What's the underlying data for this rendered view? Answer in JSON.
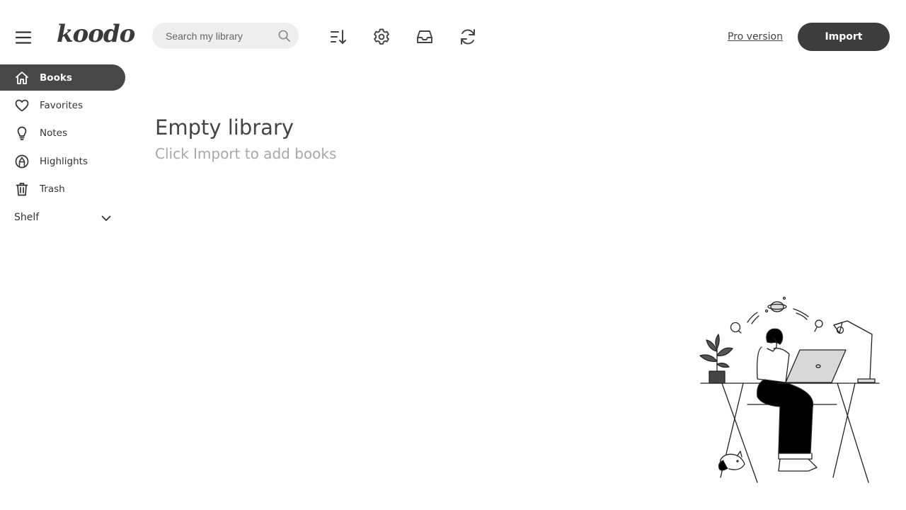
{
  "app": {
    "logo_text": "koodo"
  },
  "header": {
    "search_placeholder": "Search my library",
    "tools": [
      "sort-icon",
      "settings-icon",
      "inbox-icon",
      "sync-icon"
    ],
    "pro_label": "Pro version",
    "import_label": "Import"
  },
  "sidebar": {
    "items": [
      {
        "label": "Books",
        "icon": "home-icon",
        "active": true
      },
      {
        "label": "Favorites",
        "icon": "heart-icon",
        "active": false
      },
      {
        "label": "Notes",
        "icon": "lightbulb-icon",
        "active": false
      },
      {
        "label": "Highlights",
        "icon": "highlighter-icon",
        "active": false
      },
      {
        "label": "Trash",
        "icon": "trash-icon",
        "active": false
      }
    ],
    "shelf_label": "Shelf"
  },
  "main": {
    "empty_title": "Empty library",
    "empty_subtitle": "Click Import to add books"
  },
  "colors": {
    "accent": "#474747",
    "button": "#3d3d3d",
    "muted_text": "#a8a8a8",
    "search_bg": "#eeeeee"
  }
}
